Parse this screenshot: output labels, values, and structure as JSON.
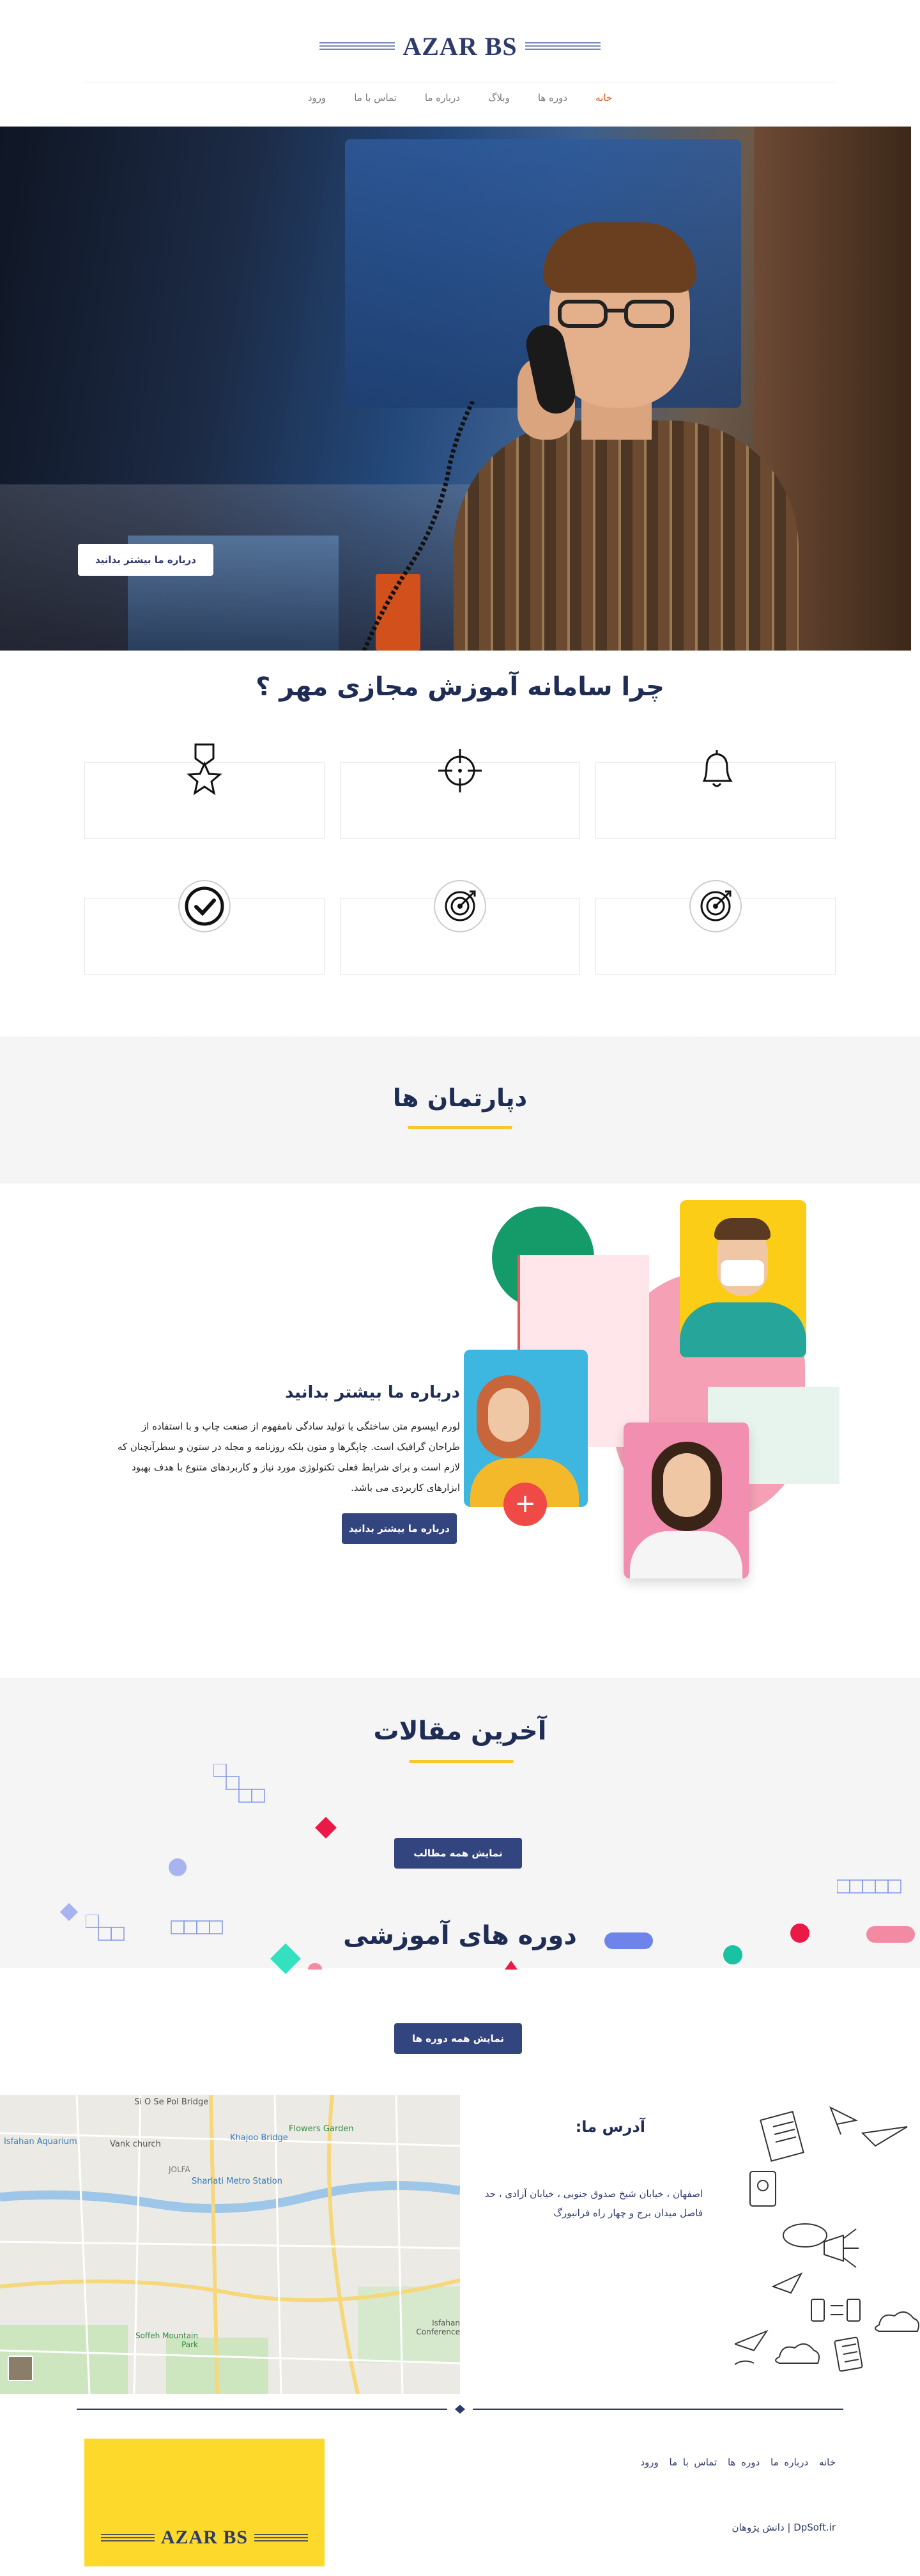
{
  "brand": {
    "logo_text": "AZAR BS"
  },
  "nav": {
    "items": [
      {
        "label": "خانه",
        "active": true
      },
      {
        "label": "دوره ها",
        "active": false
      },
      {
        "label": "وبلاگ",
        "active": false
      },
      {
        "label": "درباره ما",
        "active": false
      },
      {
        "label": "تماس با ما",
        "active": false
      },
      {
        "label": "ورود",
        "active": false
      }
    ]
  },
  "hero": {
    "button_label": "درباره ما بیشتر بدانید"
  },
  "why": {
    "title": "چرا سامانه آموزش مجازی مهر ؟",
    "features": [
      {
        "icon": "bell-icon"
      },
      {
        "icon": "crosshair-icon"
      },
      {
        "icon": "medal-icon"
      },
      {
        "icon": "target-icon"
      },
      {
        "icon": "target-icon"
      },
      {
        "icon": "check-circle-icon"
      }
    ]
  },
  "departments": {
    "title": "دپارتمان ها"
  },
  "about": {
    "heading": "درباره ما بیشتر بدانید",
    "text": "لورم ایپسوم متن ساختگی با تولید سادگی نامفهوم از صنعت چاپ و با استفاده از طراحان گرافیک است. چاپگرها و متون بلکه روزنامه و مجله در ستون و سطرآنچنان که لازم است و برای شرایط فعلی تکنولوژی مورد نیاز و کاربردهای متنوع با هدف بهبود ابزارهای کاربردی می باشد.",
    "button_label": "درباره ما بیشتر بدانید"
  },
  "articles": {
    "title": "آخرین مقالات",
    "button_label": "نمایش همه مطالب"
  },
  "courses": {
    "title": "دوره های آموزشی",
    "button_label": "نمایش همه دوره ها"
  },
  "contact": {
    "title": "آدرس ما:",
    "address": "اصفهان ، خیابان شیخ صدوق جنوبی ، خیابان آزادی ، حد فاصل میدان برج و چهار راه فرانبورگ"
  },
  "map": {
    "labels": [
      "Si O Se Pol Bridge",
      "Isfahan Aquarium",
      "Vank church",
      "Khajoo Bridge",
      "Flowers Garden",
      "JOLFA",
      "Shariati Metro Station",
      "Soffeh Mountain Park",
      "Isfahan Conference"
    ]
  },
  "footer": {
    "links": [
      "خانه",
      "درباره ما",
      "دوره ها",
      "تماس با ما",
      "ورود"
    ],
    "copyright": "DpSoft.ir | دانش پژوهان",
    "logo_text": "AZAR BS"
  },
  "colors": {
    "navy": "#33457f",
    "accent": "#e8521f",
    "yellow": "#f7c82b",
    "band": "#f5f5f5"
  }
}
